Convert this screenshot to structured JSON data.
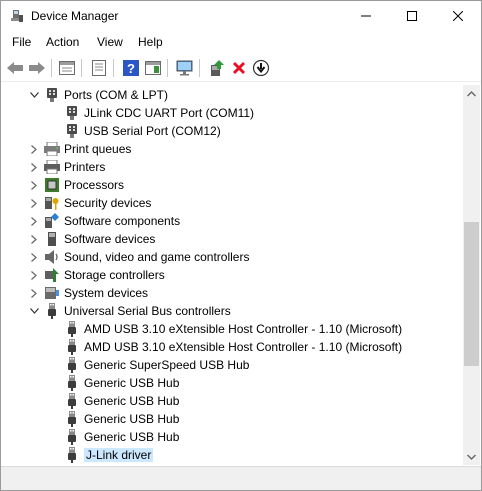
{
  "window": {
    "title": "Device Manager"
  },
  "menu": [
    "File",
    "Action",
    "View",
    "Help"
  ],
  "toolbar": {
    "items": [
      "back-icon",
      "forward-icon",
      "properties-pane-icon",
      "update-list-icon",
      "help-icon",
      "action-pane-icon",
      "scan-hardware-icon",
      "update-driver-icon",
      "uninstall-icon",
      "disable-device-icon"
    ]
  },
  "tree": {
    "rows": [
      {
        "label": "Ports (COM & LPT)",
        "level": 1,
        "expander": "expanded",
        "icon": "port-icon"
      },
      {
        "label": "JLink CDC UART Port (COM11)",
        "level": 2,
        "expander": "none",
        "icon": "port-icon"
      },
      {
        "label": "USB Serial Port (COM12)",
        "level": 2,
        "expander": "none",
        "icon": "port-icon"
      },
      {
        "label": "Print queues",
        "level": 1,
        "expander": "collapsed",
        "icon": "print-queue-icon"
      },
      {
        "label": "Printers",
        "level": 1,
        "expander": "collapsed",
        "icon": "printer-icon"
      },
      {
        "label": "Processors",
        "level": 1,
        "expander": "collapsed",
        "icon": "processor-icon"
      },
      {
        "label": "Security devices",
        "level": 1,
        "expander": "collapsed",
        "icon": "security-device-icon"
      },
      {
        "label": "Software components",
        "level": 1,
        "expander": "collapsed",
        "icon": "software-component-icon"
      },
      {
        "label": "Software devices",
        "level": 1,
        "expander": "collapsed",
        "icon": "software-device-icon"
      },
      {
        "label": "Sound, video and game controllers",
        "level": 1,
        "expander": "collapsed",
        "icon": "sound-icon"
      },
      {
        "label": "Storage controllers",
        "level": 1,
        "expander": "collapsed",
        "icon": "storage-controller-icon"
      },
      {
        "label": "System devices",
        "level": 1,
        "expander": "collapsed",
        "icon": "system-device-icon"
      },
      {
        "label": "Universal Serial Bus controllers",
        "level": 1,
        "expander": "expanded",
        "icon": "usb-icon"
      },
      {
        "label": "AMD USB 3.10 eXtensible Host Controller - 1.10 (Microsoft)",
        "level": 2,
        "expander": "none",
        "icon": "usb-icon"
      },
      {
        "label": "AMD USB 3.10 eXtensible Host Controller - 1.10 (Microsoft)",
        "level": 2,
        "expander": "none",
        "icon": "usb-icon"
      },
      {
        "label": "Generic SuperSpeed USB Hub",
        "level": 2,
        "expander": "none",
        "icon": "usb-icon"
      },
      {
        "label": "Generic USB Hub",
        "level": 2,
        "expander": "none",
        "icon": "usb-icon"
      },
      {
        "label": "Generic USB Hub",
        "level": 2,
        "expander": "none",
        "icon": "usb-icon"
      },
      {
        "label": "Generic USB Hub",
        "level": 2,
        "expander": "none",
        "icon": "usb-icon"
      },
      {
        "label": "Generic USB Hub",
        "level": 2,
        "expander": "none",
        "icon": "usb-icon"
      },
      {
        "label": "J-Link driver",
        "level": 2,
        "expander": "none",
        "icon": "usb-icon",
        "selected": true
      }
    ]
  },
  "colors": {
    "selection": "#cce8ff",
    "scroll_thumb": "#cdcdcd",
    "uninstall_red": "#e81123",
    "help_blue": "#2a56c6"
  }
}
